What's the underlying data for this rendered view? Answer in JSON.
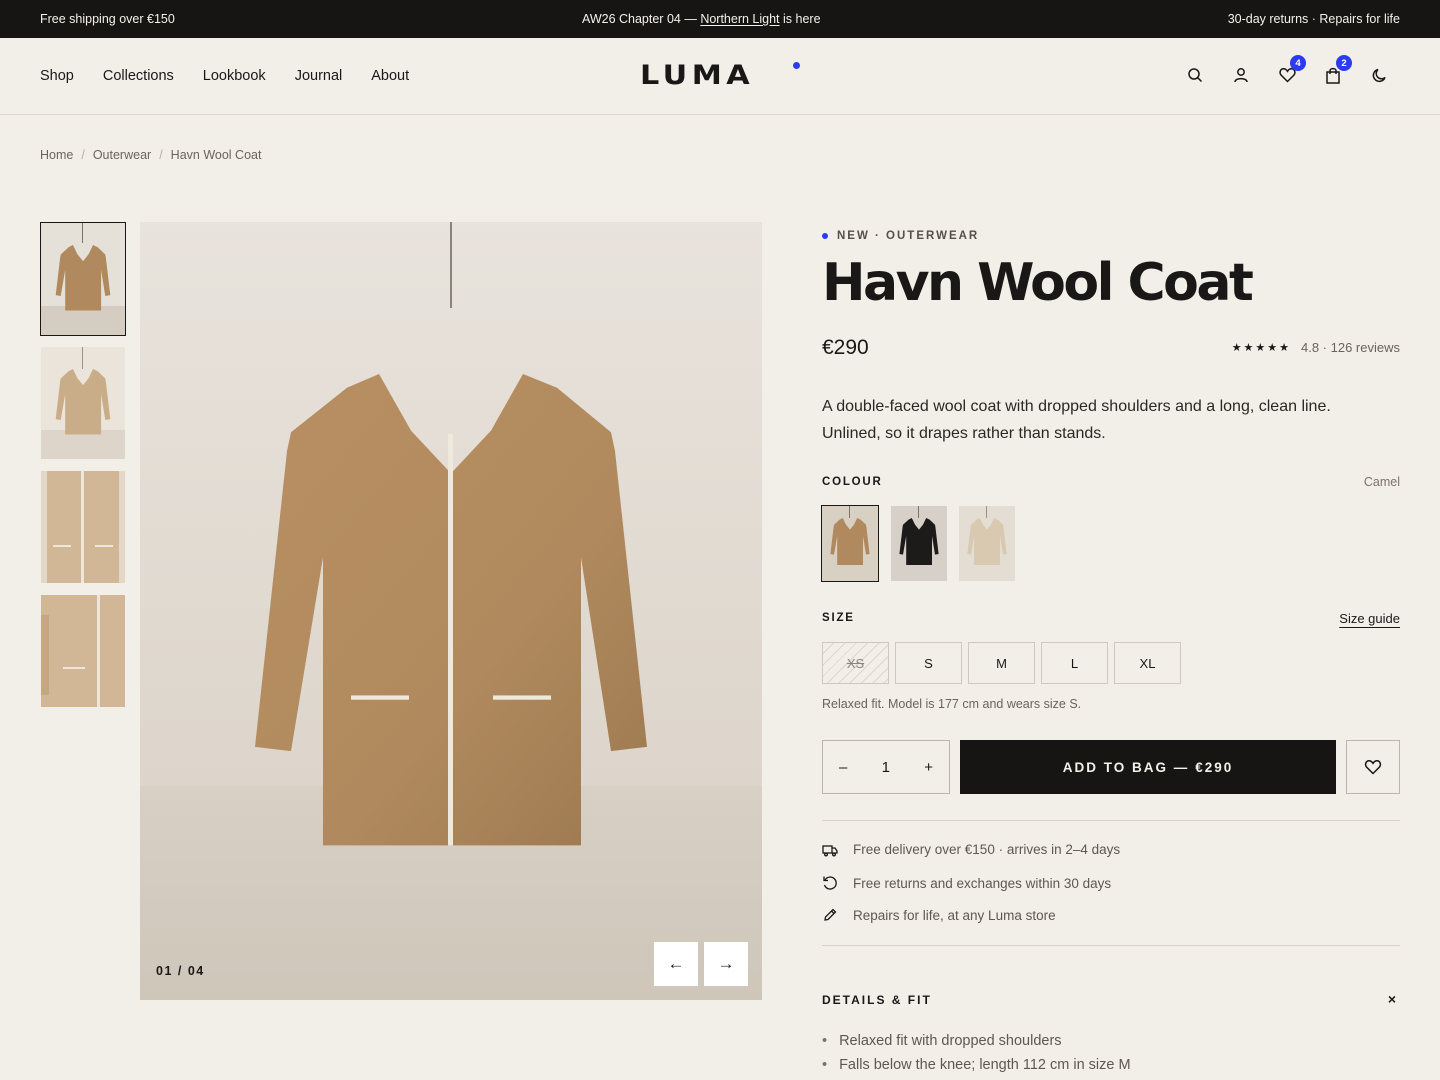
{
  "topbar": {
    "left": "Free shipping over €150",
    "center_prefix": "AW26 Chapter 04 —",
    "center_link": "Northern Light",
    "center_suffix": "is here",
    "right": "30-day returns · Repairs for life"
  },
  "nav": {
    "items": [
      "Shop",
      "Collections",
      "Lookbook",
      "Journal",
      "About"
    ]
  },
  "logo": "LUMA",
  "header_icons": {
    "wishlist_count": "4",
    "bag_count": "2"
  },
  "breadcrumb": [
    "Home",
    "Outerwear",
    "Havn Wool Coat"
  ],
  "gallery": {
    "counter": "01 / 04",
    "prev": "←",
    "next": "→"
  },
  "product": {
    "eyebrow": "NEW · OUTERWEAR",
    "title": "Havn Wool Coat",
    "price": "€290",
    "stars": "★★★★★",
    "rating": "4.8 · 126 reviews",
    "description": "A double-faced wool coat with dropped shoulders and a long, clean line. Unlined, so it drapes rather than stands.",
    "colour_label": "COLOUR",
    "colour_selected": "Camel",
    "size_label": "SIZE",
    "size_guide": "Size guide",
    "sizes": [
      "XS",
      "S",
      "M",
      "L",
      "XL"
    ],
    "fit_note": "Relaxed fit. Model is 177 cm and wears size S.",
    "qty_minus": "–",
    "qty_value": "1",
    "qty_plus": "+",
    "add_to_bag": "ADD TO BAG —",
    "add_price": "€290",
    "perks": [
      "Free delivery over €150 · arrives in 2–4 days",
      "Free returns and exchanges within 30 days",
      "Repairs for life, at any Luma store"
    ],
    "details_title": "DETAILS & FIT",
    "details_close": "×",
    "details": [
      "Relaxed fit with dropped shoulders",
      "Falls below the knee; length 112 cm in size M"
    ]
  },
  "colors": {
    "camel": "#b08a5e",
    "black": "#1c1b1a",
    "sand": "#d8c9b0",
    "accent": "#2b3cf0"
  }
}
